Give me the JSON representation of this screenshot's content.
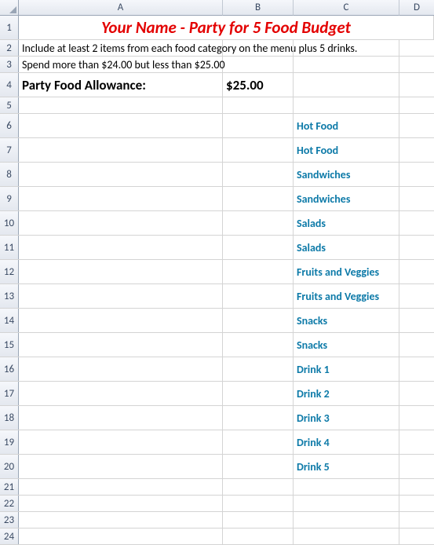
{
  "columns": {
    "A": "A",
    "B": "B",
    "C": "C",
    "D": "D"
  },
  "title": "Your Name  - Party for 5 Food Budget",
  "instr1": "Include at least 2 items from each food category on the menu plus 5 drinks.",
  "instr2": "Spend more than $24.00 but less than $25.00",
  "allowance_label": "Party Food Allowance:",
  "allowance_value": "$25.00",
  "items": [
    "Hot Food",
    "Hot Food",
    "Sandwiches",
    "Sandwiches",
    "Salads",
    "Salads",
    "Fruits and Veggies",
    "Fruits and Veggies",
    "Snacks",
    "Snacks",
    "Drink 1",
    "Drink 2",
    "Drink 3",
    "Drink 4",
    "Drink 5"
  ],
  "rownums": [
    "1",
    "2",
    "3",
    "4",
    "5",
    "6",
    "7",
    "8",
    "9",
    "10",
    "11",
    "12",
    "13",
    "14",
    "15",
    "16",
    "17",
    "18",
    "19",
    "20",
    "21",
    "22",
    "23",
    "24"
  ]
}
